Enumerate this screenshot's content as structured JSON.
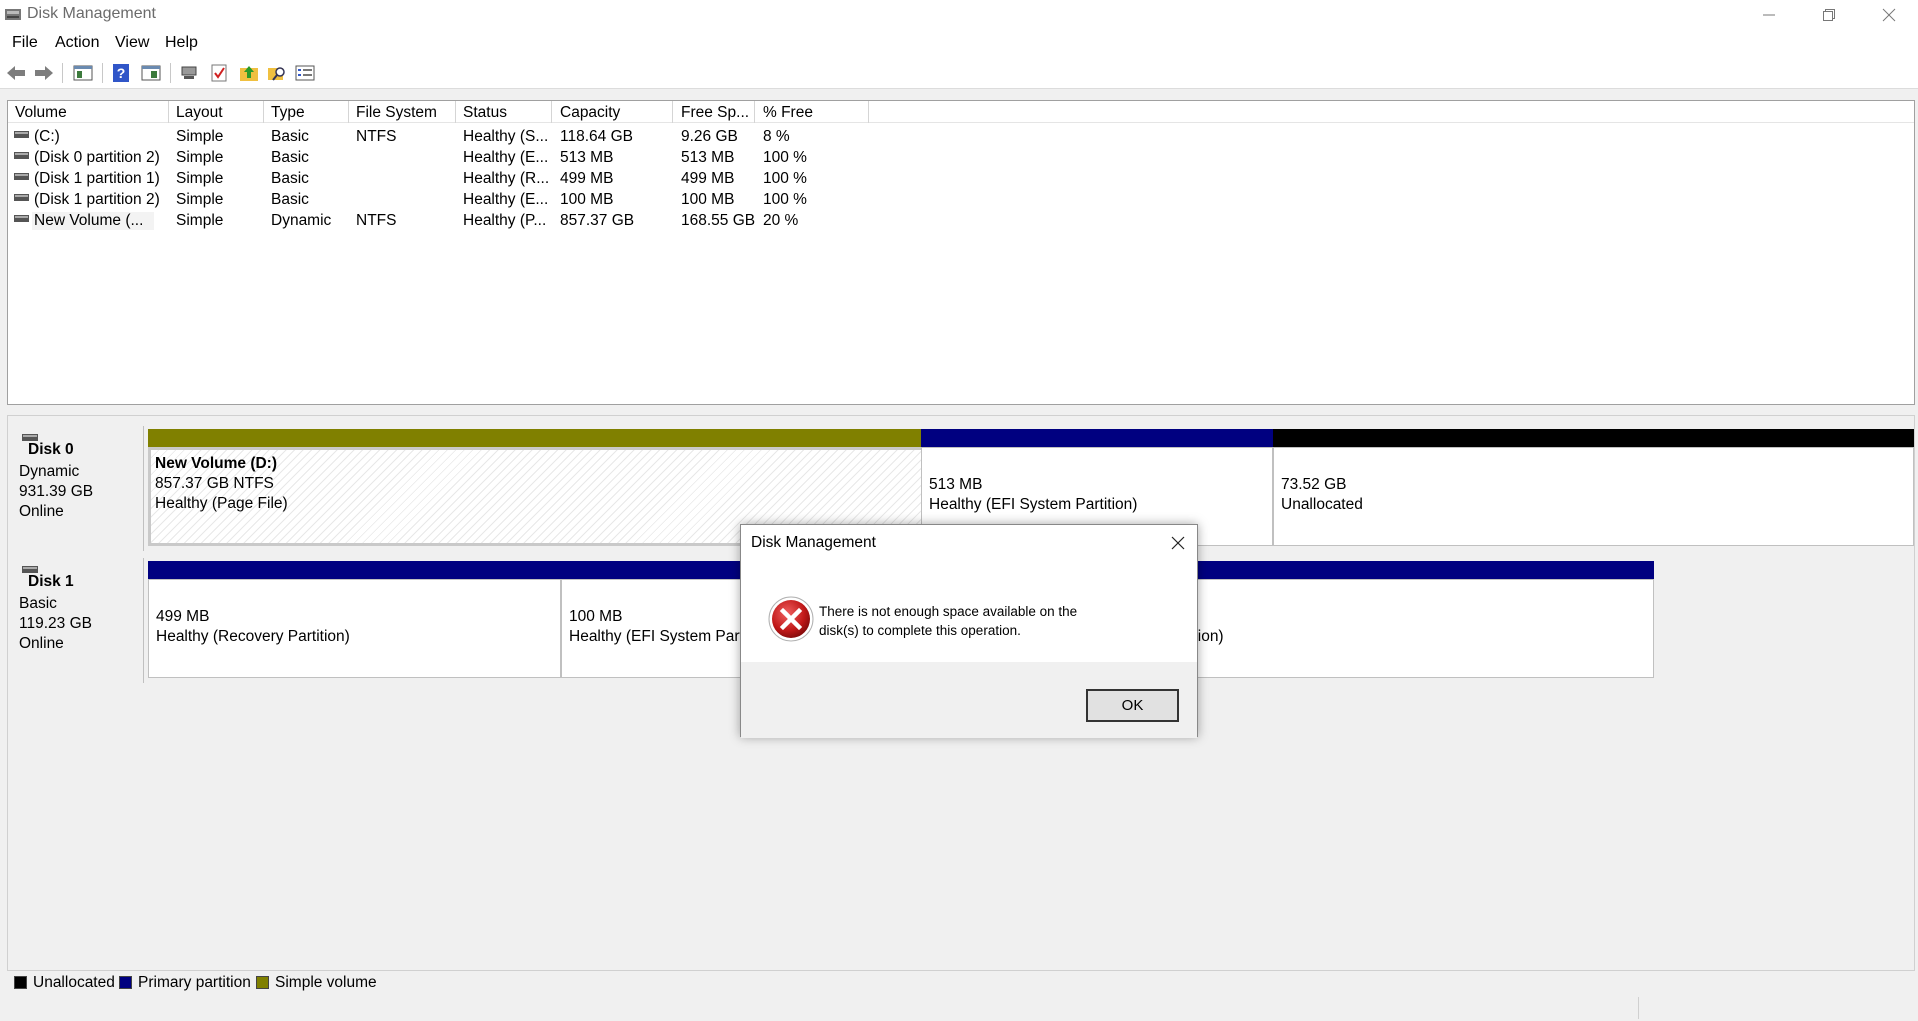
{
  "window": {
    "title": "Disk Management",
    "icon": "disk-management-icon"
  },
  "menu": {
    "items": [
      "File",
      "Action",
      "View",
      "Help"
    ]
  },
  "toolbar": {
    "buttons": [
      "back-icon",
      "forward-icon",
      "console-tree-icon",
      "help-icon",
      "properties-icon",
      "connect-icon",
      "check-icon",
      "folder-up-icon",
      "search-folder-icon",
      "list-icon"
    ]
  },
  "volume_list": {
    "columns": [
      "Volume",
      "Layout",
      "Type",
      "File System",
      "Status",
      "Capacity",
      "Free Sp...",
      "% Free"
    ],
    "rows": [
      {
        "volume": "(C:)",
        "layout": "Simple",
        "type": "Basic",
        "fs": "NTFS",
        "status": "Healthy (S...",
        "capacity": "118.64 GB",
        "free": "9.26 GB",
        "pct": "8 %"
      },
      {
        "volume": "(Disk 0 partition 2)",
        "layout": "Simple",
        "type": "Basic",
        "fs": "",
        "status": "Healthy (E...",
        "capacity": "513 MB",
        "free": "513 MB",
        "pct": "100 %"
      },
      {
        "volume": "(Disk 1 partition 1)",
        "layout": "Simple",
        "type": "Basic",
        "fs": "",
        "status": "Healthy (R...",
        "capacity": "499 MB",
        "free": "499 MB",
        "pct": "100 %"
      },
      {
        "volume": "(Disk 1 partition 2)",
        "layout": "Simple",
        "type": "Basic",
        "fs": "",
        "status": "Healthy (E...",
        "capacity": "100 MB",
        "free": "100 MB",
        "pct": "100 %"
      },
      {
        "volume": "New Volume (...",
        "layout": "Simple",
        "type": "Dynamic",
        "fs": "NTFS",
        "status": "Healthy (P...",
        "capacity": "857.37 GB",
        "free": "168.55 GB",
        "pct": "20 %"
      }
    ]
  },
  "disks": [
    {
      "name": "Disk 0",
      "type": "Dynamic",
      "size": "931.39 GB",
      "state": "Online",
      "partitions": [
        {
          "title": "New Volume  (D:)",
          "size": "857.37 GB NTFS",
          "status": "Healthy (Page File)",
          "color": "#808000"
        },
        {
          "title": "",
          "size": "513 MB",
          "status": "Healthy (EFI System Partition)",
          "color": "#000080"
        },
        {
          "title": "",
          "size": "73.52 GB",
          "status": "Unallocated",
          "color": "#000000"
        }
      ]
    },
    {
      "name": "Disk 1",
      "type": "Basic",
      "size": "119.23 GB",
      "state": "Online",
      "partitions": [
        {
          "title": "",
          "size": "499 MB",
          "status": "Healthy (Recovery Partition)",
          "color": "#000080"
        },
        {
          "title": "",
          "size": "100 MB",
          "status": "Healthy (EFI System Partiti",
          "color": "#000080"
        },
        {
          "title": "",
          "size": "",
          "status": "ition)",
          "color": "#000080"
        }
      ]
    }
  ],
  "legend": [
    {
      "label": "Unallocated",
      "color": "#000000"
    },
    {
      "label": "Primary partition",
      "color": "#000080"
    },
    {
      "label": "Simple volume",
      "color": "#808000"
    }
  ],
  "dialog": {
    "title": "Disk Management",
    "message": "There is not enough space available on the disk(s) to complete this operation.",
    "ok_label": "OK",
    "icon": "error-icon"
  }
}
